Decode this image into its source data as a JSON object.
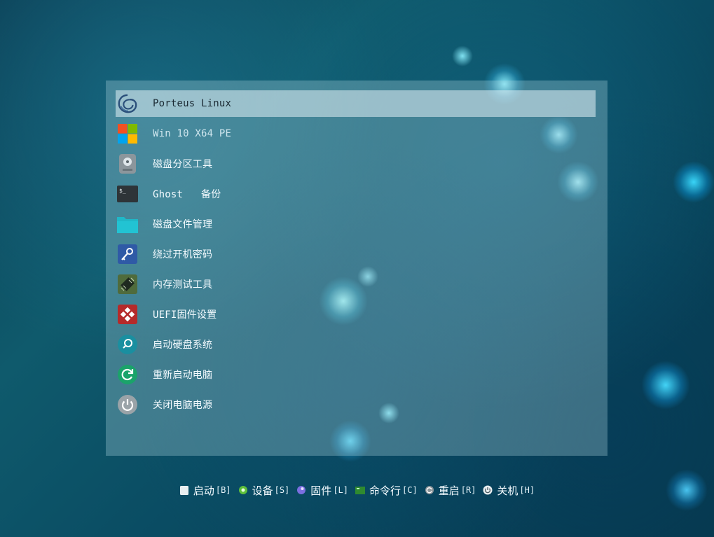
{
  "menu": {
    "items": [
      {
        "label": "Porteus Linux",
        "icon": "porteus-swirl-icon"
      },
      {
        "label": "Win 10 X64 PE",
        "icon": "windows-logo-icon"
      },
      {
        "label": "磁盘分区工具",
        "icon": "disk-partition-icon"
      },
      {
        "label": "Ghost   备份",
        "icon": "terminal-icon"
      },
      {
        "label": "磁盘文件管理",
        "icon": "folder-icon"
      },
      {
        "label": "绕过开机密码",
        "icon": "key-icon"
      },
      {
        "label": "内存测试工具",
        "icon": "memory-chip-icon"
      },
      {
        "label": "UEFI固件设置",
        "icon": "firmware-icon"
      },
      {
        "label": "启动硬盘系统",
        "icon": "search-disk-icon"
      },
      {
        "label": "重新启动电脑",
        "icon": "restart-icon"
      },
      {
        "label": "关闭电脑电源",
        "icon": "power-icon"
      }
    ],
    "selected_index": 0
  },
  "hotkeys": [
    {
      "label": "启动",
      "key": "[B]",
      "icon": "boot-square-icon"
    },
    {
      "label": "设备",
      "key": "[S]",
      "icon": "device-gear-icon"
    },
    {
      "label": "固件",
      "key": "[L]",
      "icon": "firmware-orb-icon"
    },
    {
      "label": "命令行",
      "key": "[C]",
      "icon": "console-icon"
    },
    {
      "label": "重启",
      "key": "[R]",
      "icon": "reboot-icon"
    },
    {
      "label": "关机",
      "key": "[H]",
      "icon": "shutdown-icon"
    }
  ],
  "colors": {
    "panel": "#afd7e1",
    "selected_row": "#e1f0f5",
    "text": "#f4fbff"
  }
}
